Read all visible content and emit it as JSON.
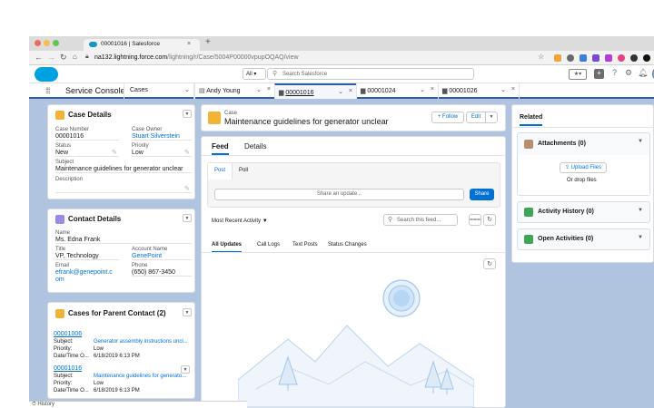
{
  "browser": {
    "tab_title": "00001016 | Salesforce",
    "new_tab": "+",
    "url_host": "na132.lightning.force.com",
    "url_path": "/lightning/r/Case/5004P00000vpupOQAQ/view",
    "status_bar": "History"
  },
  "header": {
    "search_scope": "All",
    "search_placeholder": "Search Salesforce"
  },
  "app": {
    "name": "Service Console",
    "nav_select": "Cases",
    "tabs": [
      {
        "label": "Andy Young"
      },
      {
        "label": "00001016"
      },
      {
        "label": "00001024"
      },
      {
        "label": "00001026"
      }
    ]
  },
  "case_details": {
    "title": "Case Details",
    "case_number_label": "Case Number",
    "case_number": "00001016",
    "case_owner_label": "Case Owner",
    "case_owner": "Stuart Silverstein",
    "status_label": "Status",
    "status": "New",
    "priority_label": "Priority",
    "priority": "Low",
    "subject_label": "Subject",
    "subject": "Maintenance guidelines for generator unclear",
    "description_label": "Description"
  },
  "contact_details": {
    "title": "Contact Details",
    "name_label": "Name",
    "name": "Ms. Edna Frank",
    "title_label": "Title",
    "title_value": "VP, Technology",
    "account_label": "Account Name",
    "account": "GenePoint",
    "email_label": "Email",
    "email_line1": "efrank@genepoint.c",
    "email_line2": "om",
    "phone_label": "Phone",
    "phone": "(650) 867-3450"
  },
  "parent_cases": {
    "title": "Cases for Parent Contact (2)",
    "subject_label": "Subject:",
    "priority_label": "Priority:",
    "date_label": "Date/Time O...",
    "items": [
      {
        "number": "00001006",
        "subject": "Generator assembly instructions uncl...",
        "priority": "Low",
        "date": "6/18/2019 6:13 PM"
      },
      {
        "number": "00001016",
        "subject": "Maintenance guidelines for generato...",
        "priority": "Low",
        "date": "6/18/2019 6:13 PM"
      }
    ]
  },
  "case_header": {
    "object_label": "Case",
    "title": "Maintenance guidelines for generator unclear",
    "follow_label": "Follow",
    "edit_label": "Edit"
  },
  "feed": {
    "tabs": [
      "Feed",
      "Details"
    ],
    "publisher_tabs": [
      "Post",
      "Poll"
    ],
    "share_placeholder": "Share an update...",
    "share_button": "Share",
    "sort_label": "Most Recent Activity",
    "search_placeholder": "Search this feed...",
    "filters": [
      "All Updates",
      "Call Logs",
      "Text Posts",
      "Status Changes"
    ]
  },
  "related": {
    "tab": "Related",
    "attachments_title": "Attachments (0)",
    "upload_label": "Upload Files",
    "drop_label": "Or drop files",
    "activity_title": "Activity History (0)",
    "open_title": "Open Activities (0)"
  },
  "colors": {
    "accent_blue": "#0070d2",
    "nav_underline": "#2e5ea7",
    "workspace_bg": "#b0c4df",
    "case_icon": "#f2b337",
    "contact_icon": "#9b8ae4",
    "activity_icon": "#3ba755"
  }
}
